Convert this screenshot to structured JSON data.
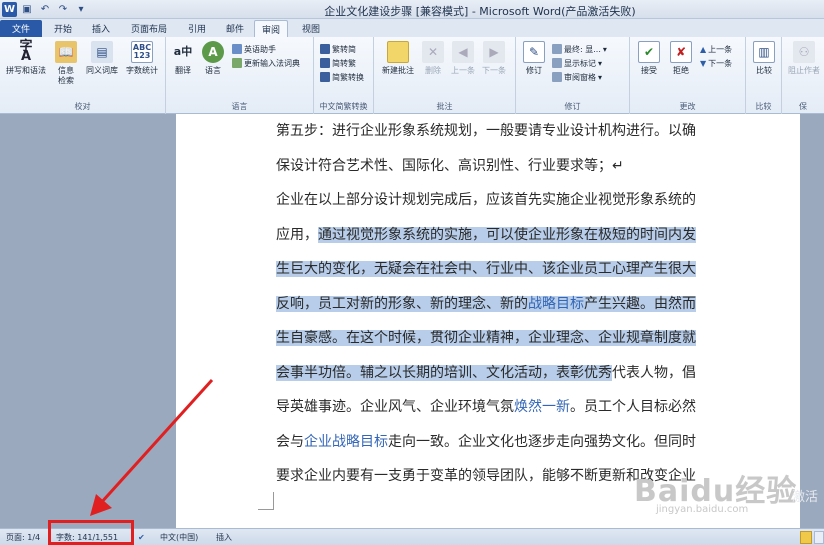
{
  "window": {
    "title": "企业文化建设步骤 [兼容模式] - Microsoft Word(产品激活失败)"
  },
  "tabs": [
    {
      "label": "文件",
      "type": "file"
    },
    {
      "label": "开始"
    },
    {
      "label": "插入"
    },
    {
      "label": "页面布局"
    },
    {
      "label": "引用"
    },
    {
      "label": "邮件"
    },
    {
      "label": "审阅",
      "active": true
    },
    {
      "label": "视图"
    }
  ],
  "ribbon": {
    "proofing": {
      "label": "校对",
      "spell": "拼写和语法",
      "research": "信息\n检索",
      "thesaurus": "同义词库",
      "wordcount": "字数统计"
    },
    "language": {
      "label": "语言",
      "translate": "翻译",
      "lang": "语言",
      "english_assist": "英语助手",
      "update_ime": "更新输入法词典"
    },
    "chinese": {
      "label": "中文简繁转换",
      "to_trad": "繁转简",
      "to_simp": "简转繁",
      "convert": "简繁转换"
    },
    "comments": {
      "label": "批注",
      "new": "新建批注",
      "delete": "删除",
      "prev": "上一条",
      "next": "下一条"
    },
    "tracking": {
      "label": "修订",
      "track": "修订",
      "final_show": "最终: 显...",
      "show_markup": "显示标记",
      "review_pane": "审阅窗格"
    },
    "changes": {
      "label": "更改",
      "accept": "接受",
      "reject": "拒绝",
      "prev": "上一条",
      "next": "下一条"
    },
    "compare": {
      "label": "比较",
      "compare": "比较"
    },
    "protect": {
      "label": "保",
      "block_authors": "阻止作者"
    }
  },
  "document": {
    "lines": [
      [
        {
          "t": "第五步：进行企业形象系统规划，一般要请专业设计机构进行。以确"
        }
      ],
      [
        {
          "t": "保设计符合艺术性、国际化、高识别性、行业要求等；↵"
        }
      ],
      [
        {
          "t": "企业在以上部分设计规划完成后，应该首先实施企业视觉形象系统的"
        }
      ],
      [
        {
          "t": "应用，"
        },
        {
          "t": "通过视觉形象系统的实施，可以使企业形象在极短的时间内发",
          "hl": true
        }
      ],
      [
        {
          "t": "生巨大的变化，无疑会在社会中、行业中、该企业员工心理产生很大",
          "hl": true
        }
      ],
      [
        {
          "t": "反响，员工对新的形象、新的理念、新的",
          "hl": true
        },
        {
          "t": "战略目标",
          "hl": true,
          "link": true
        },
        {
          "t": "产生兴趣。由然而",
          "hl": true
        }
      ],
      [
        {
          "t": "生自豪感。在这个时候，贯彻企业精神，企业理念、企业规章制度就",
          "hl": true
        }
      ],
      [
        {
          "t": "会事半功倍。辅之以长期的培训、文化活动，表彰优秀",
          "hl": true
        },
        {
          "t": "代表人物，倡"
        }
      ],
      [
        {
          "t": "导英雄事迹。企业风气、企业环境气氛"
        },
        {
          "t": "焕然一新",
          "link": true
        },
        {
          "t": "。员工个人目标必然"
        }
      ],
      [
        {
          "t": "会与"
        },
        {
          "t": "企业战略目标",
          "link": true
        },
        {
          "t": "走向一致。企业文化也逐步走向强势文化。但同时"
        }
      ],
      [
        {
          "t": "要求企业内要有一支勇于变革的领导团队，能够不断更新和改变企业"
        }
      ]
    ]
  },
  "status": {
    "page": "页面: 1/4",
    "wordcount": "字数: 141/1,551",
    "language": "中文(中国)",
    "mode": "插入"
  },
  "watermark": {
    "brand": "Baidu经验",
    "url": "jingyan.baidu.com",
    "activate": "激活"
  },
  "colors": {
    "accent": "#2a5aa7",
    "highlight": "#b7cde9",
    "annotation": "#e02020"
  }
}
